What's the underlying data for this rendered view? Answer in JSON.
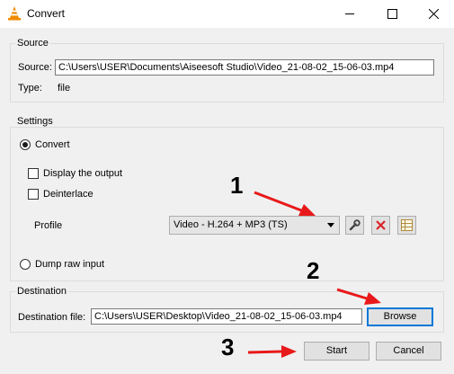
{
  "window": {
    "title": "Convert"
  },
  "source": {
    "legend": "Source",
    "source_label": "Source:",
    "source_value": "C:\\Users\\USER\\Documents\\Aiseesoft Studio\\Video_21-08-02_15-06-03.mp4",
    "type_label": "Type:",
    "type_value": "file"
  },
  "settings": {
    "legend": "Settings",
    "convert_label": "Convert",
    "display_output_label": "Display the output",
    "deinterlace_label": "Deinterlace",
    "profile_label": "Profile",
    "profile_value": "Video - H.264 + MP3 (TS)",
    "dump_raw_label": "Dump raw input",
    "convert_selected": true,
    "display_output_checked": false,
    "deinterlace_checked": false
  },
  "destination": {
    "legend": "Destination",
    "file_label": "Destination file:",
    "file_value": "C:\\Users\\USER\\Desktop\\Video_21-08-02_15-06-03.mp4",
    "browse_label": "Browse"
  },
  "footer": {
    "start_label": "Start",
    "cancel_label": "Cancel"
  },
  "annotations": {
    "step1": "1",
    "step2": "2",
    "step3": "3",
    "color": "#e8191a"
  },
  "icons": {
    "app": "vlc-cone-icon",
    "edit_profile": "wrench-icon",
    "delete_profile": "red-x-icon",
    "new_profile": "table-grid-icon"
  }
}
